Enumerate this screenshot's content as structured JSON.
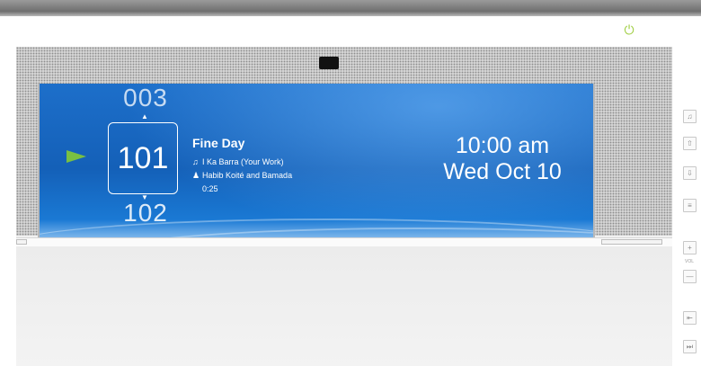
{
  "channels": {
    "previous": "003",
    "current": "101",
    "next": "102"
  },
  "now_playing": {
    "title": "Fine Day",
    "song": "I Ka Barra (Your Work)",
    "artist": "Habib Koité and Bamada",
    "elapsed": "0:25"
  },
  "clock": {
    "time": "10:00 am",
    "date": "Wed Oct 10"
  },
  "side_controls": {
    "music": "♫",
    "up": "⇧",
    "down": "⇩",
    "menu": "≡",
    "vol_plus": "+",
    "vol_label": "VOL",
    "vol_minus": "—",
    "back": "⇤",
    "skip": "⏭"
  },
  "icons": {
    "power": "⏻",
    "play": "play-icon",
    "note": "♫",
    "person": "♟",
    "arrow_up": "▲",
    "arrow_down": "▼"
  },
  "colors": {
    "accent_green": "#79c043",
    "screen_blue": "#1460b8"
  }
}
